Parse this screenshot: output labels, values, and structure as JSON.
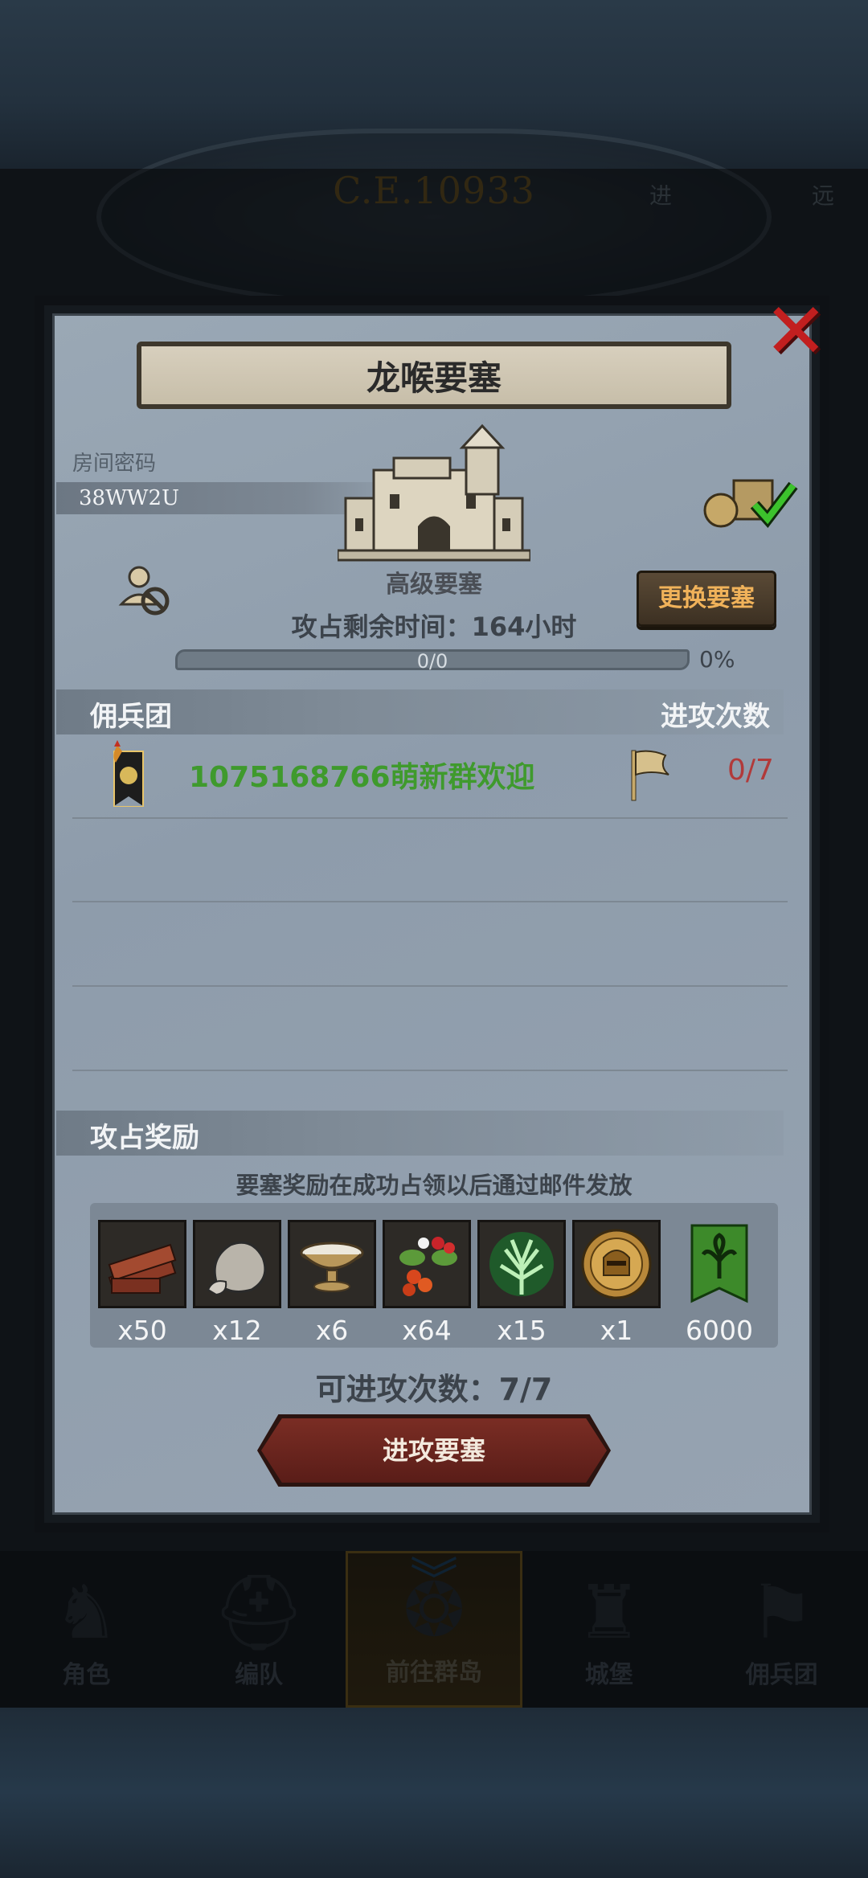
{
  "background": {
    "year": "C.E.10933",
    "corner_right": "远",
    "corner_mid": "进"
  },
  "nav": {
    "items": [
      {
        "label": "角色",
        "icon": "knight-icon"
      },
      {
        "label": "编队",
        "icon": "helmet-icon"
      },
      {
        "label": "前往群岛",
        "icon": "compass-icon"
      },
      {
        "label": "城堡",
        "icon": "castle-icon"
      },
      {
        "label": "佣兵团",
        "icon": "banner-icon"
      }
    ],
    "active_index": 2
  },
  "dialog": {
    "title": "龙喉要塞",
    "room_label": "房间密码",
    "room_code": "38WW2U",
    "castle_name": "高级要塞",
    "time_remaining": "攻占剩余时间：164小时",
    "progress_text": "0/0",
    "progress_value": 0,
    "progress_percent": "0%",
    "change_button": "更换要塞",
    "mercenary_header": "佣兵团",
    "attack_count_header": "进攻次数",
    "mercenaries": [
      {
        "name": "1075168766萌新群欢迎",
        "attacks": "0/7"
      }
    ],
    "rewards_header": "攻占奖励",
    "rewards_note": "要塞奖励在成功占领以后通过邮件发放",
    "rewards": [
      {
        "icon": "wood-icon",
        "qty": "x50"
      },
      {
        "icon": "stone-icon",
        "qty": "x12"
      },
      {
        "icon": "bowl-icon",
        "qty": "x6"
      },
      {
        "icon": "berries-icon",
        "qty": "x64"
      },
      {
        "icon": "herb-icon",
        "qty": "x15"
      },
      {
        "icon": "helmet-medal-icon",
        "qty": "x1"
      },
      {
        "icon": "guild-banner-icon",
        "qty": "6000"
      }
    ],
    "attacks_left": "可进攻次数：7/7",
    "attack_button": "进攻要塞"
  },
  "colors": {
    "dialog_bg": "#96a3b1",
    "mercenary_name": "#3f9a2d",
    "attack_count": "#b13a3a",
    "close": "#c21f1f",
    "change_button_text": "#f0b25a"
  }
}
